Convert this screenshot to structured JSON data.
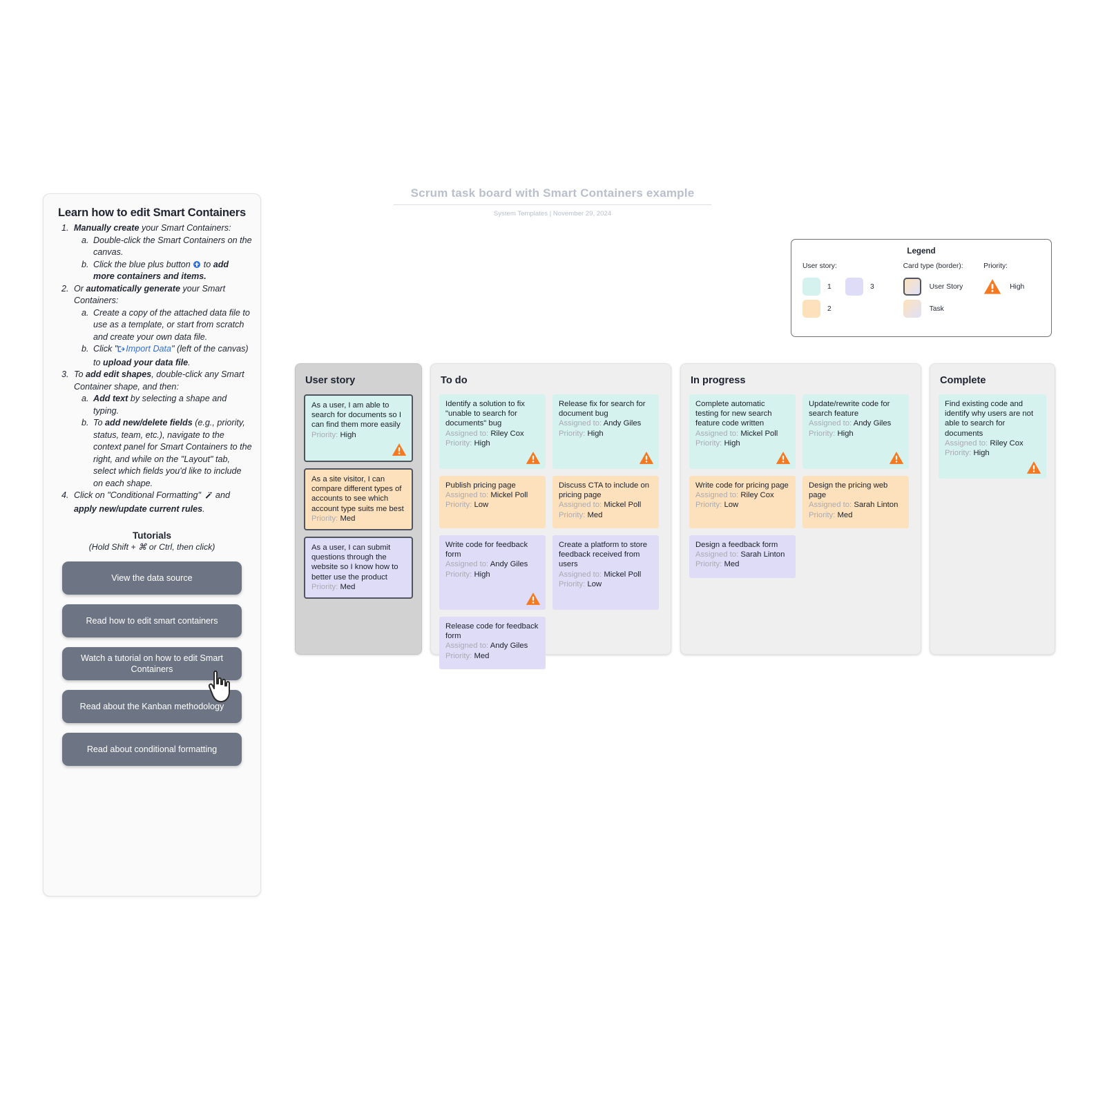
{
  "instructions": {
    "heading": "Learn how to edit Smart Containers",
    "i1_a": "Manually create",
    "i1_b": " your Smart Containers:",
    "i1a": "Double-click the Smart Containers on the canvas.",
    "i1b_pre": "Click the blue plus button ",
    "i1b_post": " to ",
    "i1b_bold": "add more containers and items.",
    "i2_pre": "Or ",
    "i2_bold": "automatically generate",
    "i2_post": " your Smart Containers:",
    "i2a": "Create a copy of the attached data file to use as a template, or start from scratch and create your own data file.",
    "i2b_pre": "Click \"",
    "i2b_link": "Import Data",
    "i2b_mid": "\" (left of the canvas) to ",
    "i2b_bold": "upload your data file",
    "i2b_end": ".",
    "i3_pre": "To ",
    "i3_bold": "add edit shapes",
    "i3_post": ", double-click any Smart Container shape, and then:",
    "i3a_bold": "Add text",
    "i3a_post": " by selecting a shape and typing.",
    "i3b_pre": "To ",
    "i3b_bold": "add new/delete fields",
    "i3b_post": " (e.g., priority, status, team, etc.), navigate to the context panel for Smart Containers to the right, and while on the \"Layout\" tab, select which fields you'd like to include on each shape.",
    "i4_pre": "Click on \"Conditional Formatting\" ",
    "i4_mid": " and ",
    "i4_bold": "apply new/update current rules",
    "i4_end": ".",
    "tutorials_title": "Tutorials",
    "tutorials_sub": "(Hold Shift + ⌘ or Ctrl, then click)",
    "buttons": [
      "View the data source",
      "Read how to edit smart containers",
      "Watch a tutorial on how to edit Smart Containers",
      "Read about the Kanban methodology",
      "Read about conditional formatting"
    ]
  },
  "board_header": {
    "title": "Scrum task board with Smart Containers example",
    "subtitle": "System Templates  |  November 29, 2024"
  },
  "legend": {
    "title": "Legend",
    "user_story_head": "User story:",
    "card_type_head": "Card type (border):",
    "priority_head": "Priority:",
    "swatches": [
      {
        "label": "1",
        "color": "#d5f2ef"
      },
      {
        "label": "3",
        "color": "#dedcf7"
      },
      {
        "label": "2",
        "color": "#fde1bd"
      }
    ],
    "card_types": [
      {
        "label": "User Story"
      },
      {
        "label": "Task"
      }
    ],
    "priority": {
      "label": "High",
      "color": "#f47920"
    }
  },
  "columns": [
    {
      "title": "User story",
      "style": "story",
      "cards": [
        {
          "title": "As a user, I am able to search for documents so I can find them more easily",
          "assigned_label": null,
          "assigned": null,
          "priority_label": "Priority:",
          "priority": "High",
          "color": "teal",
          "warn": true
        },
        {
          "title": "As a site visitor, I can compare different types of accounts to see which account type suits me best",
          "assigned_label": null,
          "assigned": null,
          "priority_label": "Priority:",
          "priority": "Med",
          "color": "peach",
          "warn": false
        },
        {
          "title": "As a user, I can submit questions through the website so I know how to better use the product",
          "assigned_label": null,
          "assigned": null,
          "priority_label": "Priority:",
          "priority": "Med",
          "color": "lav",
          "warn": false
        }
      ]
    },
    {
      "title": "To do",
      "style": "task",
      "cards": [
        {
          "title": "Identify a solution to fix \"unable to search for documents\" bug",
          "assigned_label": "Assigned to:",
          "assigned": "Riley Cox",
          "priority_label": "Priority:",
          "priority": "High",
          "color": "teal",
          "warn": true
        },
        {
          "title": "Release fix for search for document bug",
          "assigned_label": "Assigned to:",
          "assigned": "Andy Giles",
          "priority_label": "Priority:",
          "priority": "High",
          "color": "teal",
          "warn": true
        },
        {
          "title": "Publish pricing page",
          "assigned_label": "Assigned to:",
          "assigned": "Mickel Poll",
          "priority_label": "Priority:",
          "priority": "Low",
          "color": "peach",
          "warn": false
        },
        {
          "title": "Discuss CTA to include on pricing page",
          "assigned_label": "Assigned to:",
          "assigned": "Mickel Poll",
          "priority_label": "Priority:",
          "priority": "Med",
          "color": "peach",
          "warn": false
        },
        {
          "title": "Write code for feedback form",
          "assigned_label": "Assigned to:",
          "assigned": "Andy Giles",
          "priority_label": "Priority:",
          "priority": "High",
          "color": "lav",
          "warn": true
        },
        {
          "title": "Create a platform to store feedback received from users",
          "assigned_label": "Assigned to:",
          "assigned": "Mickel Poll",
          "priority_label": "Priority:",
          "priority": "Low",
          "color": "lav",
          "warn": false
        },
        {
          "title": "Release code for feedback form",
          "assigned_label": "Assigned to:",
          "assigned": "Andy Giles",
          "priority_label": "Priority:",
          "priority": "Med",
          "color": "lav",
          "warn": false
        }
      ]
    },
    {
      "title": "In progress",
      "style": "task",
      "cards": [
        {
          "title": "Complete automatic testing for new search feature code written",
          "assigned_label": "Assigned to:",
          "assigned": "Mickel Poll",
          "priority_label": "Priority:",
          "priority": "High",
          "color": "teal",
          "warn": true
        },
        {
          "title": "Update/rewrite code for search feature",
          "assigned_label": "Assigned to:",
          "assigned": "Andy Giles",
          "priority_label": "Priority:",
          "priority": "High",
          "color": "teal",
          "warn": true
        },
        {
          "title": "Write code for pricing page",
          "assigned_label": "Assigned to:",
          "assigned": "Riley Cox",
          "priority_label": "Priority:",
          "priority": "Low",
          "color": "peach",
          "warn": false
        },
        {
          "title": "Design the pricing web page",
          "assigned_label": "Assigned to:",
          "assigned": "Sarah Linton",
          "priority_label": "Priority:",
          "priority": "Med",
          "color": "peach",
          "warn": false
        },
        {
          "title": "Design a feedback form",
          "assigned_label": "Assigned to:",
          "assigned": "Sarah Linton",
          "priority_label": "Priority:",
          "priority": "Med",
          "color": "lav",
          "warn": false
        }
      ]
    },
    {
      "title": "Complete",
      "style": "task",
      "cards": [
        {
          "title": "Find existing code and identify why users are not able to search for documents",
          "assigned_label": "Assigned to:",
          "assigned": "Riley Cox",
          "priority_label": "Priority:",
          "priority": "High",
          "color": "teal",
          "warn": true
        }
      ]
    }
  ]
}
